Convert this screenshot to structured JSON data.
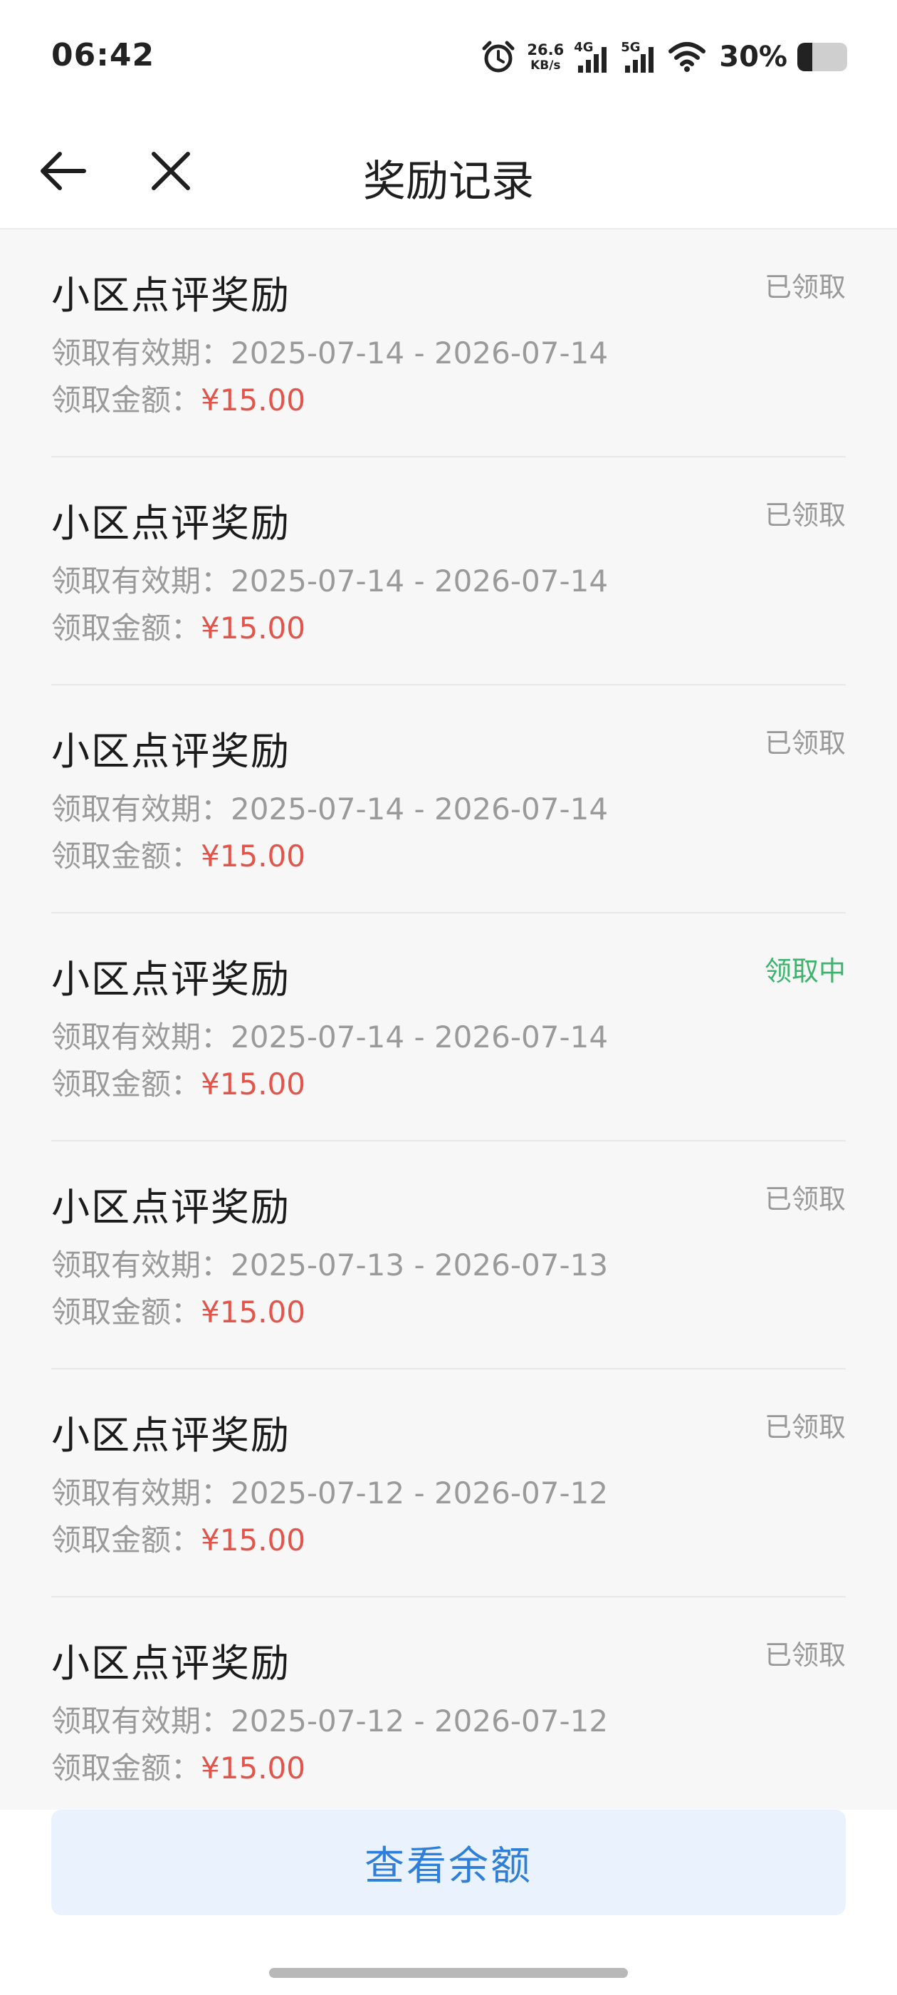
{
  "status_bar": {
    "time": "06:42",
    "net_speed_value": "26.6",
    "net_speed_unit": "KB/s",
    "signal1_label": "4G",
    "signal2_label": "5G",
    "battery_percent": "30%",
    "battery_level": 0.3
  },
  "header": {
    "title": "奖励记录",
    "back_icon": "arrow-left-icon",
    "close_icon": "close-icon"
  },
  "records": [
    {
      "title": "小区点评奖励",
      "status": "已领取",
      "period_label": "领取有效期：",
      "period": "2025-07-14 - 2026-07-14",
      "amount_label": "领取金额：",
      "amount": "¥15.00",
      "pending": false
    },
    {
      "title": "小区点评奖励",
      "status": "已领取",
      "period_label": "领取有效期：",
      "period": "2025-07-14 - 2026-07-14",
      "amount_label": "领取金额：",
      "amount": "¥15.00",
      "pending": false
    },
    {
      "title": "小区点评奖励",
      "status": "已领取",
      "period_label": "领取有效期：",
      "period": "2025-07-14 - 2026-07-14",
      "amount_label": "领取金额：",
      "amount": "¥15.00",
      "pending": false
    },
    {
      "title": "小区点评奖励",
      "status": "领取中",
      "period_label": "领取有效期：",
      "period": "2025-07-14 - 2026-07-14",
      "amount_label": "领取金额：",
      "amount": "¥15.00",
      "pending": true
    },
    {
      "title": "小区点评奖励",
      "status": "已领取",
      "period_label": "领取有效期：",
      "period": "2025-07-13 - 2026-07-13",
      "amount_label": "领取金额：",
      "amount": "¥15.00",
      "pending": false
    },
    {
      "title": "小区点评奖励",
      "status": "已领取",
      "period_label": "领取有效期：",
      "period": "2025-07-12 - 2026-07-12",
      "amount_label": "领取金额：",
      "amount": "¥15.00",
      "pending": false
    },
    {
      "title": "小区点评奖励",
      "status": "已领取",
      "period_label": "领取有效期：",
      "period": "2025-07-12 - 2026-07-12",
      "amount_label": "领取金额：",
      "amount": "¥15.00",
      "pending": false
    }
  ],
  "bottom": {
    "balance_button": "查看余额"
  },
  "colors": {
    "amount": "#e2554b",
    "status_done": "#999999",
    "status_pending": "#3fb36e",
    "button_bg": "#e9f2fd",
    "button_text": "#2f7fd8"
  }
}
